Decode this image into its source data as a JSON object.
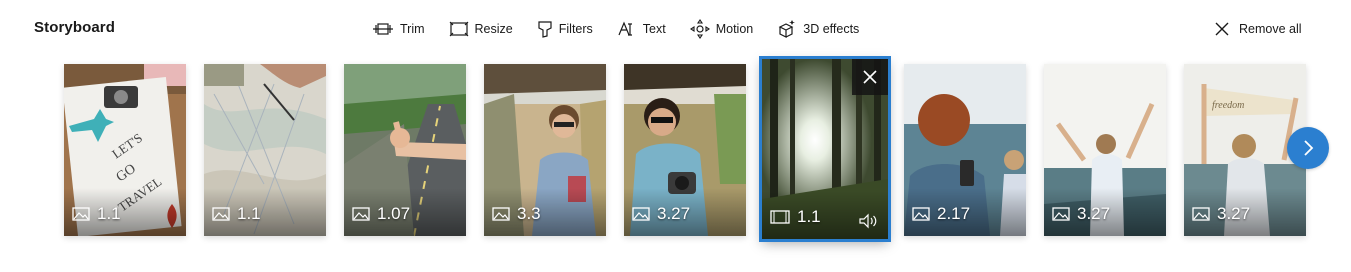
{
  "header": {
    "title": "Storyboard",
    "remove_all_label": "Remove all"
  },
  "toolbar": {
    "trim_label": "Trim",
    "resize_label": "Resize",
    "filters_label": "Filters",
    "text_label": "Text",
    "motion_label": "Motion",
    "effects_label": "3D effects"
  },
  "clips": [
    {
      "duration": "1.1",
      "type": "image",
      "subject": "lets-go-travel-flatlay"
    },
    {
      "duration": "1.1",
      "type": "image",
      "subject": "hand-on-map"
    },
    {
      "duration": "1.07",
      "type": "image",
      "subject": "hitchhiker-road"
    },
    {
      "duration": "3.3",
      "type": "image",
      "subject": "woman-in-cart"
    },
    {
      "duration": "3.27",
      "type": "image",
      "subject": "woman-with-camera"
    },
    {
      "duration": "1.1",
      "type": "video",
      "subject": "sun-through-forest",
      "selected": true
    },
    {
      "duration": "2.17",
      "type": "image",
      "subject": "woman-with-phone-sea"
    },
    {
      "duration": "3.27",
      "type": "image",
      "subject": "woman-arms-raised"
    },
    {
      "duration": "3.27",
      "type": "image",
      "subject": "woman-freedom-banner"
    }
  ],
  "colors": {
    "accent": "#2b7fd0",
    "text": "#1a1a1a"
  }
}
